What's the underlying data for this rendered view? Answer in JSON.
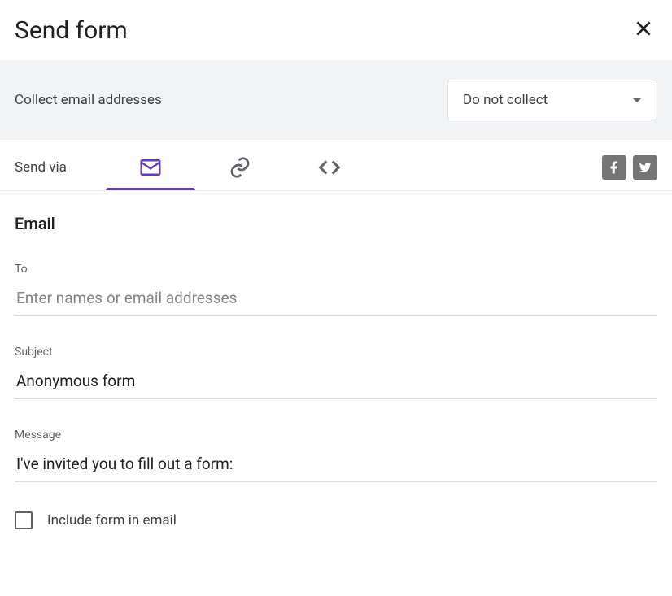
{
  "dialog": {
    "title": "Send form"
  },
  "collect": {
    "label": "Collect email addresses",
    "dropdown_value": "Do not collect"
  },
  "send_via": {
    "label": "Send via"
  },
  "email": {
    "heading": "Email",
    "to_label": "To",
    "to_placeholder": "Enter names or email addresses",
    "to_value": "",
    "subject_label": "Subject",
    "subject_value": "Anonymous form",
    "message_label": "Message",
    "message_value": "I've invited you to fill out a form:",
    "include_checkbox_label": "Include form in email"
  }
}
